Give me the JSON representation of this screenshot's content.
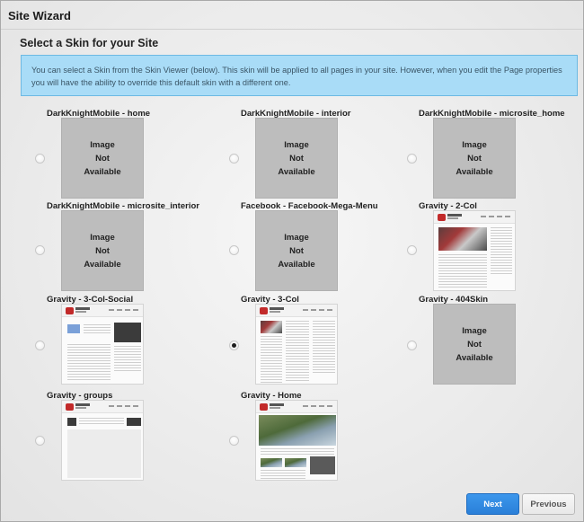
{
  "window": {
    "title": "Site Wizard"
  },
  "section": {
    "title": "Select a Skin for your Site"
  },
  "info": {
    "text": "You can select a Skin from the Skin Viewer (below). This skin will be applied to all pages in your site. However, when you edit the Page properties you will have the ability to override this default skin with a different one."
  },
  "placeholder": {
    "line1": "Image",
    "line2": "Not",
    "line3": "Available"
  },
  "skins": [
    {
      "name": "DarkKnightMobile - home",
      "thumbnail": "none",
      "selected": false
    },
    {
      "name": "DarkKnightMobile - interior",
      "thumbnail": "none",
      "selected": false
    },
    {
      "name": "DarkKnightMobile - microsite_home",
      "thumbnail": "none",
      "selected": false
    },
    {
      "name": "DarkKnightMobile - microsite_interior",
      "thumbnail": "none",
      "selected": false
    },
    {
      "name": "Facebook - Facebook-Mega-Menu",
      "thumbnail": "none",
      "selected": false
    },
    {
      "name": "Gravity - 2-Col",
      "thumbnail": "screenshot",
      "selected": false
    },
    {
      "name": "Gravity - 3-Col-Social",
      "thumbnail": "screenshot",
      "selected": false
    },
    {
      "name": "Gravity - 3-Col",
      "thumbnail": "screenshot",
      "selected": true
    },
    {
      "name": "Gravity - 404Skin",
      "thumbnail": "none",
      "selected": false
    },
    {
      "name": "Gravity - groups",
      "thumbnail": "screenshot",
      "selected": false
    },
    {
      "name": "Gravity - Home",
      "thumbnail": "screenshot",
      "selected": false
    }
  ],
  "buttons": {
    "next": "Next",
    "previous": "Previous"
  },
  "colors": {
    "info_bg": "#a9dcf7",
    "next_button": "#2f8ae0",
    "placeholder_bg": "#bdbdbd"
  }
}
